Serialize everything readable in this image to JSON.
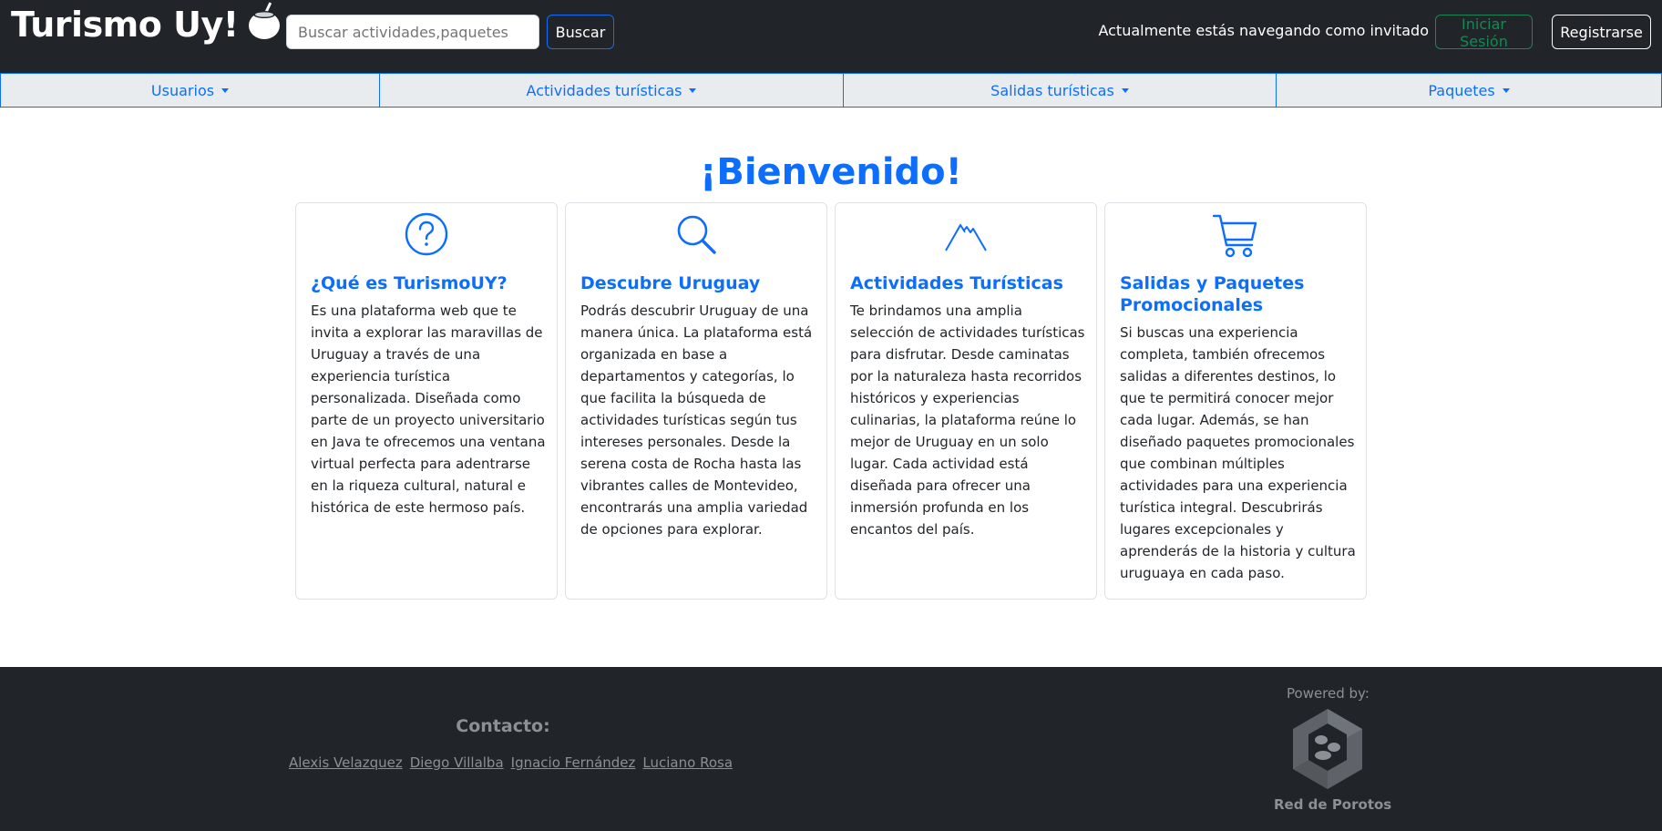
{
  "header": {
    "brand": "Turismo Uy!",
    "search_placeholder": "Buscar actividades,paquetes",
    "search_button": "Buscar",
    "guest_text": "Actualmente estás navegando como invitado",
    "login_button": "Iniciar Sesión",
    "register_button": "Registrarse"
  },
  "nav": {
    "items": [
      {
        "label": "Usuarios"
      },
      {
        "label": "Actividades turísticas"
      },
      {
        "label": "Salidas turísticas"
      },
      {
        "label": "Paquetes"
      }
    ]
  },
  "main": {
    "title": "¡Bienvenido!",
    "cards": [
      {
        "icon": "question-circle-icon",
        "title": "¿Qué es TurismoUY?",
        "text": "Es una plataforma web que te invita a explorar las maravillas de Uruguay a través de una experiencia turística personalizada. Diseñada como parte de un proyecto universitario en Java te ofrecemos una ventana virtual perfecta para adentrarse en la riqueza cultural, natural e histórica de este hermoso país."
      },
      {
        "icon": "search-icon",
        "title": "Descubre Uruguay",
        "text": "Podrás descubrir Uruguay de una manera única. La plataforma está organizada en base a departamentos y categorías, lo que facilita la búsqueda de actividades turísticas según tus intereses personales. Desde la serena costa de Rocha hasta las vibrantes calles de Montevideo, encontrarás una amplia variedad de opciones para explorar."
      },
      {
        "icon": "mountain-icon",
        "title": "Actividades Turísticas",
        "text": "Te brindamos una amplia selección de actividades turísticas para disfrutar. Desde caminatas por la naturaleza hasta recorridos históricos y experiencias culinarias, la plataforma reúne lo mejor de Uruguay en un solo lugar. Cada actividad está diseñada para ofrecer una inmersión profunda en los encantos del país."
      },
      {
        "icon": "cart-icon",
        "title": "Salidas y Paquetes Promocionales",
        "text": "Si buscas una experiencia completa, también ofrecemos salidas a diferentes destinos, lo que te permitirá conocer mejor cada lugar. Además, se han diseñado paquetes promocionales que combinan múltiples actividades para una experiencia turística integral. Descubrirás lugares excepcionales y aprenderás de la historia y cultura uruguaya en cada paso."
      }
    ]
  },
  "footer": {
    "contact_title": "Contacto:",
    "contacts": [
      "Alexis Velazquez",
      "Diego Villalba",
      "Ignacio Fernández",
      "Luciano Rosa"
    ],
    "powered_by": "Powered by:",
    "logo_text": "Red de Porotos"
  },
  "colors": {
    "header_bg": "#212529",
    "accent": "#0d6efd",
    "success": "#198754",
    "nav_bg": "#e9ecef",
    "footer_text": "#8b9096"
  }
}
